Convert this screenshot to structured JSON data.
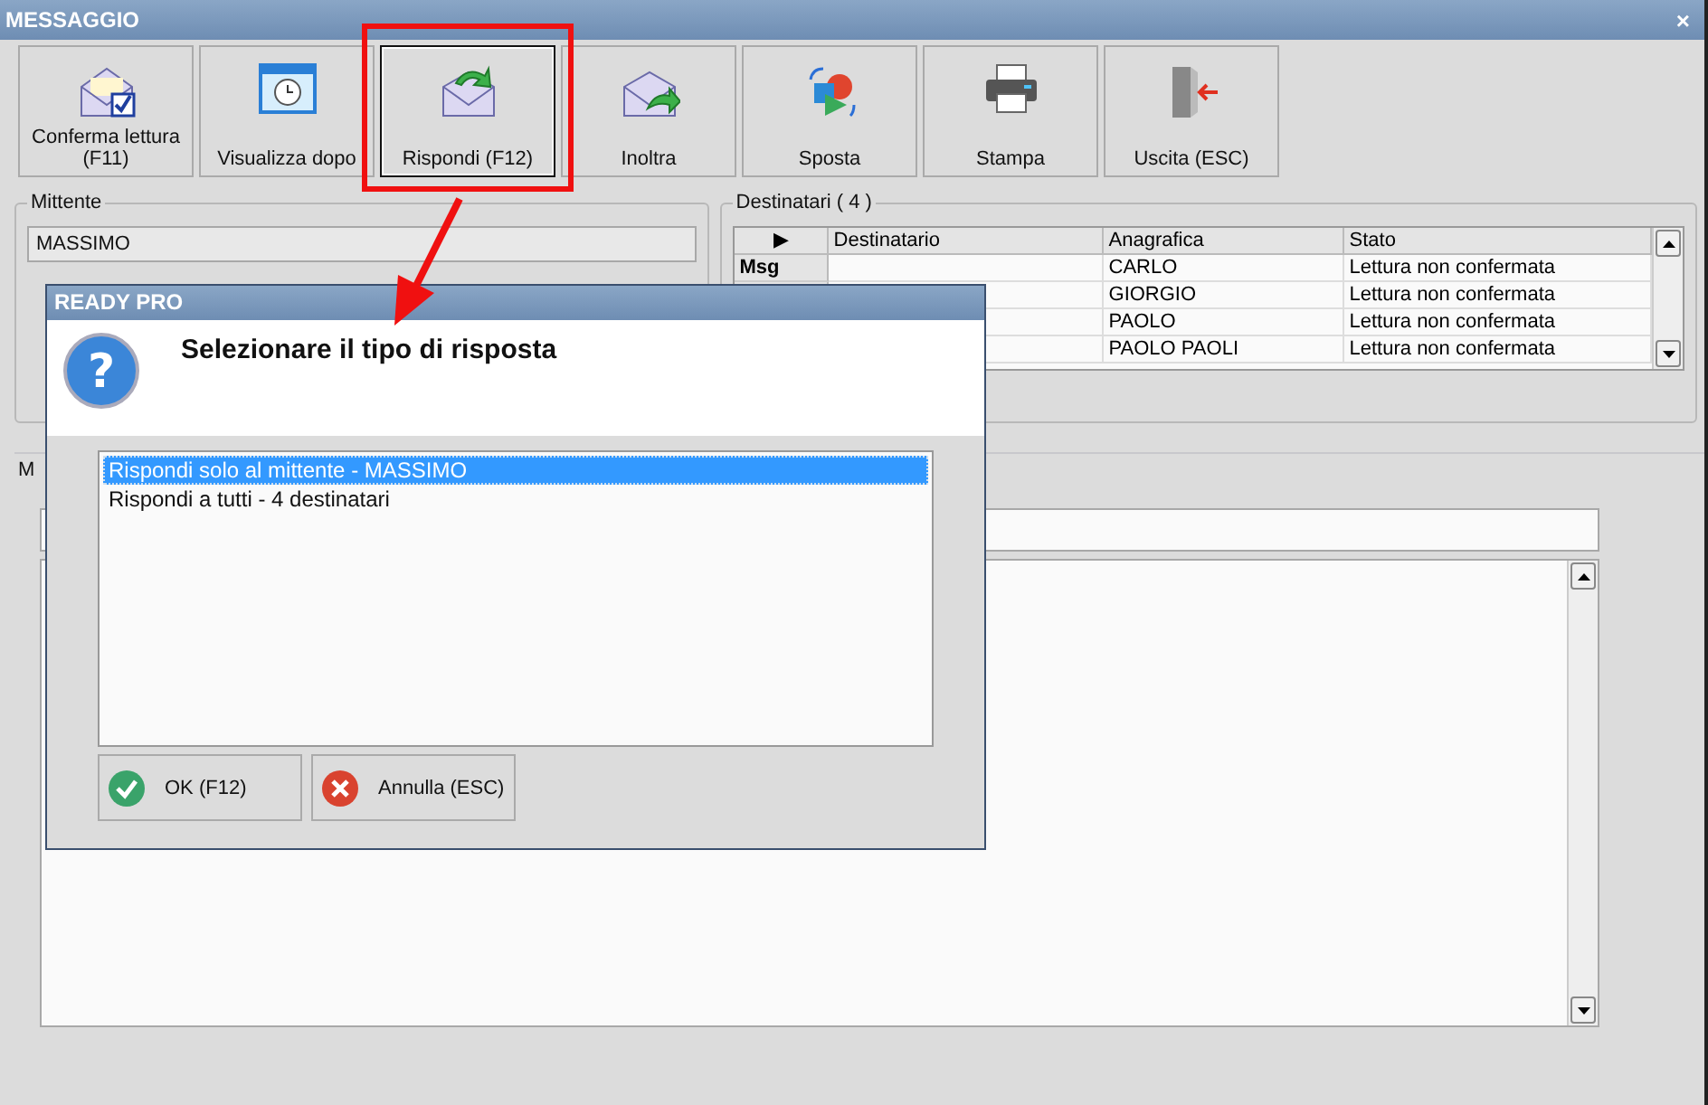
{
  "window": {
    "title": "MESSAGGIO",
    "close": "×"
  },
  "toolbar": [
    {
      "label": "Conferma lettura (F11)",
      "kind": "confirm",
      "selected": false
    },
    {
      "label": "Visualizza dopo",
      "kind": "later",
      "selected": false
    },
    {
      "label": "Rispondi (F12)",
      "kind": "reply",
      "selected": true
    },
    {
      "label": "Inoltra",
      "kind": "forward",
      "selected": false
    },
    {
      "label": "Sposta",
      "kind": "move",
      "selected": false
    },
    {
      "label": "Stampa",
      "kind": "print",
      "selected": false
    },
    {
      "label": "Uscita (ESC)",
      "kind": "exit",
      "selected": false
    }
  ],
  "sender": {
    "label": "Mittente",
    "value": "MASSIMO"
  },
  "recipients": {
    "label": "Destinatari ( 4 )",
    "columns": [
      "▶",
      "Destinatario",
      "Anagrafica",
      "Stato"
    ],
    "rows": [
      {
        "header": "Msg",
        "name": "CARLO",
        "status": "Lettura non confermata"
      },
      {
        "name": "GIORGIO",
        "status": "Lettura non confermata"
      },
      {
        "name": "PAOLO",
        "status": "Lettura non confermata"
      },
      {
        "name": "PAOLO PAOLI",
        "status": "Lettura non confermata"
      }
    ]
  },
  "message": {
    "label": "M"
  },
  "dialog": {
    "title": "READY PRO",
    "icon": "?",
    "prompt": "Selezionare il tipo di risposta",
    "options": [
      {
        "label": "Rispondi solo al mittente - MASSIMO",
        "selected": true
      },
      {
        "label": "Rispondi a tutti - 4 destinatari",
        "selected": false
      }
    ],
    "buttons": [
      {
        "label": "OK (F12)",
        "kind": "ok"
      },
      {
        "label": "Annulla (ESC)",
        "kind": "cancel"
      }
    ]
  }
}
